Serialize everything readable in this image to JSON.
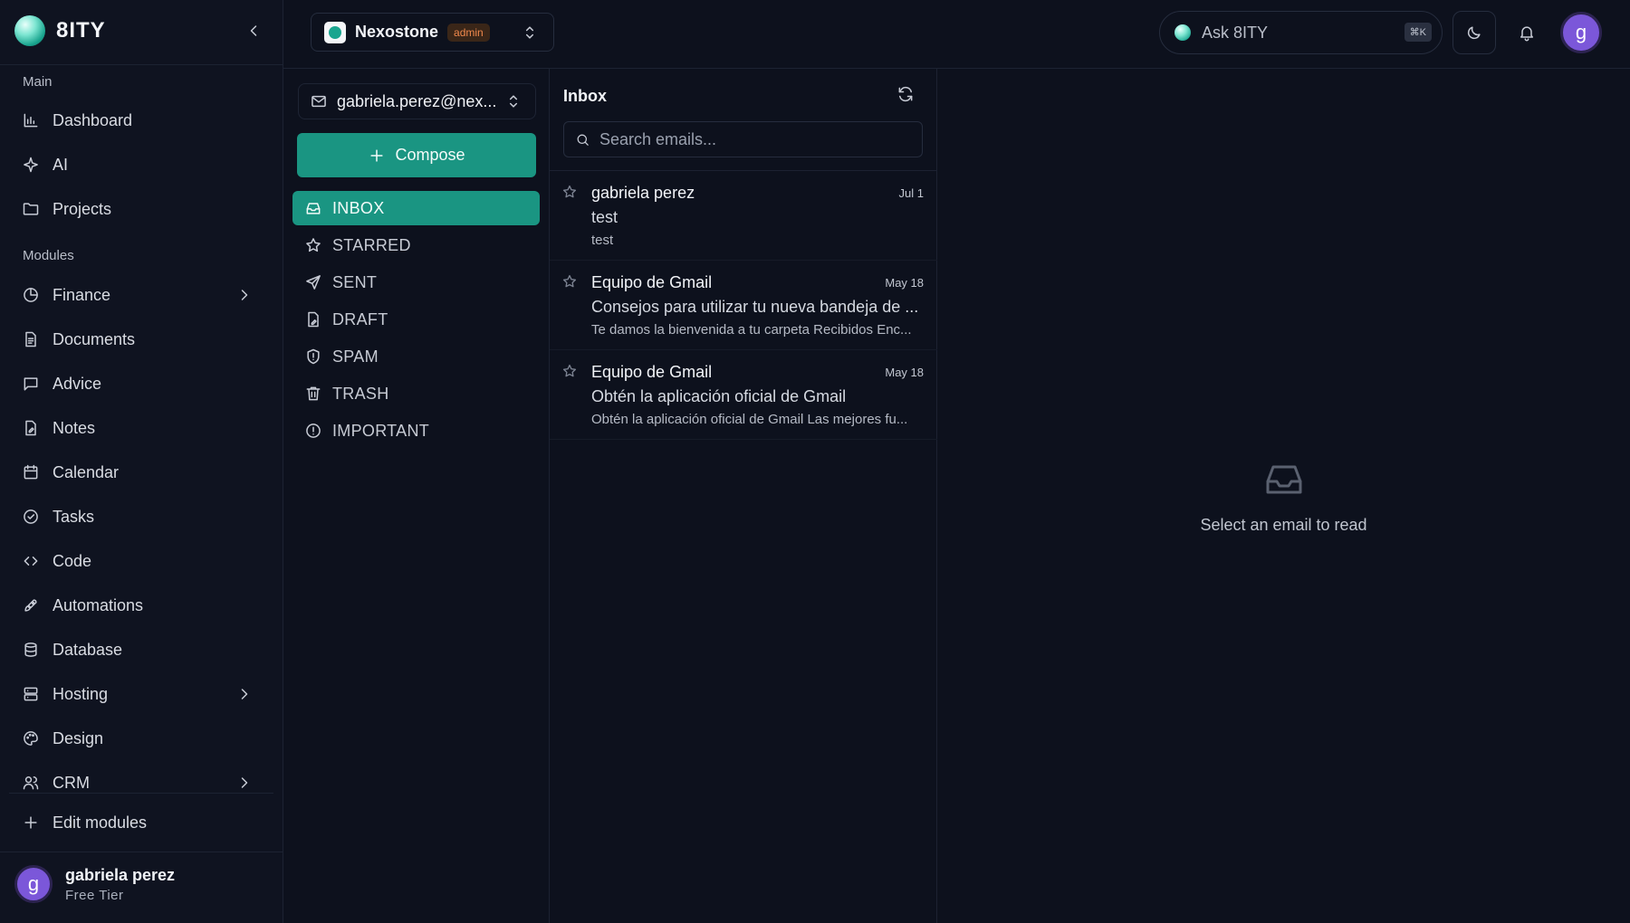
{
  "brand": {
    "name": "8ITY"
  },
  "sidebar": {
    "main_label": "Main",
    "main_items": [
      {
        "label": "Dashboard",
        "icon": "bar-chart-icon"
      },
      {
        "label": "AI",
        "icon": "sparkle-icon"
      },
      {
        "label": "Projects",
        "icon": "folder-icon"
      }
    ],
    "modules_label": "Modules",
    "module_items": [
      {
        "label": "Finance",
        "icon": "pie-chart-icon",
        "expandable": true
      },
      {
        "label": "Documents",
        "icon": "document-icon"
      },
      {
        "label": "Advice",
        "icon": "message-icon"
      },
      {
        "label": "Notes",
        "icon": "note-icon"
      },
      {
        "label": "Calendar",
        "icon": "calendar-icon"
      },
      {
        "label": "Tasks",
        "icon": "check-circle-icon"
      },
      {
        "label": "Code",
        "icon": "code-icon"
      },
      {
        "label": "Automations",
        "icon": "rocket-icon"
      },
      {
        "label": "Database",
        "icon": "database-icon"
      },
      {
        "label": "Hosting",
        "icon": "server-icon",
        "expandable": true
      },
      {
        "label": "Design",
        "icon": "palette-icon"
      },
      {
        "label": "CRM",
        "icon": "users-icon",
        "expandable": true
      }
    ],
    "edit_modules": "Edit modules",
    "user": {
      "initial": "g",
      "name": "gabriela perez",
      "tier": "Free Tier"
    }
  },
  "topbar": {
    "org_name": "Nexostone",
    "org_role": "admin",
    "ask_placeholder": "Ask 8ITY",
    "ask_shortcut": "⌘K",
    "avatar_initial": "g"
  },
  "mail": {
    "account": "gabriela.perez@nex...",
    "compose_label": "Compose",
    "folders": [
      {
        "label": "INBOX",
        "icon": "inbox-icon",
        "active": true
      },
      {
        "label": "STARRED",
        "icon": "star-icon"
      },
      {
        "label": "SENT",
        "icon": "send-icon"
      },
      {
        "label": "DRAFT",
        "icon": "draft-icon"
      },
      {
        "label": "SPAM",
        "icon": "shield-icon"
      },
      {
        "label": "TRASH",
        "icon": "trash-icon"
      },
      {
        "label": "IMPORTANT",
        "icon": "alert-circle-icon"
      }
    ],
    "list_title": "Inbox",
    "search_placeholder": "Search emails...",
    "emails": [
      {
        "from": "gabriela perez",
        "date": "Jul 1",
        "subject": "test",
        "preview": "test"
      },
      {
        "from": "Equipo de Gmail",
        "date": "May 18",
        "subject": "Consejos para utilizar tu nueva bandeja de ...",
        "preview": "Te damos la bienvenida a tu carpeta Recibidos Enc..."
      },
      {
        "from": "Equipo de Gmail",
        "date": "May 18",
        "subject": "Obtén la aplicación oficial de Gmail",
        "preview": "Obtén la aplicación oficial de Gmail Las mejores fu..."
      }
    ],
    "empty_message": "Select an email to read"
  },
  "colors": {
    "accent": "#1a9582",
    "background": "#0d111d",
    "avatar": "#7b57d9",
    "badge": "#f0884c"
  }
}
